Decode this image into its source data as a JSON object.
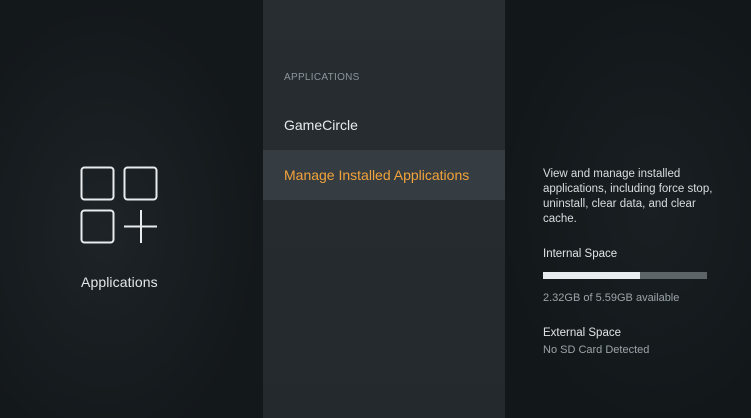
{
  "left_panel": {
    "category_icon": "apps-grid-plus-icon",
    "category_label": "Applications"
  },
  "middle_panel": {
    "section_heading": "APPLICATIONS",
    "menu_items": [
      {
        "label": "GameCircle",
        "selected": false
      },
      {
        "label": "Manage Installed Applications",
        "selected": true
      }
    ]
  },
  "right_panel": {
    "description": "View and manage installed applications, including force stop, uninstall, clear data, and clear cache.",
    "internal_space": {
      "heading": "Internal Space",
      "used_fraction": 0.59,
      "summary": "2.32GB of 5.59GB available"
    },
    "external_space": {
      "heading": "External Space",
      "status": "No SD Card Detected"
    }
  },
  "colors": {
    "selected_text": "#f2a33a",
    "selected_background": "#363d42",
    "middle_background": "#262c30",
    "screen_background": "#12171a",
    "storage_fill": "#e9ecee",
    "storage_track": "#5d6468"
  }
}
